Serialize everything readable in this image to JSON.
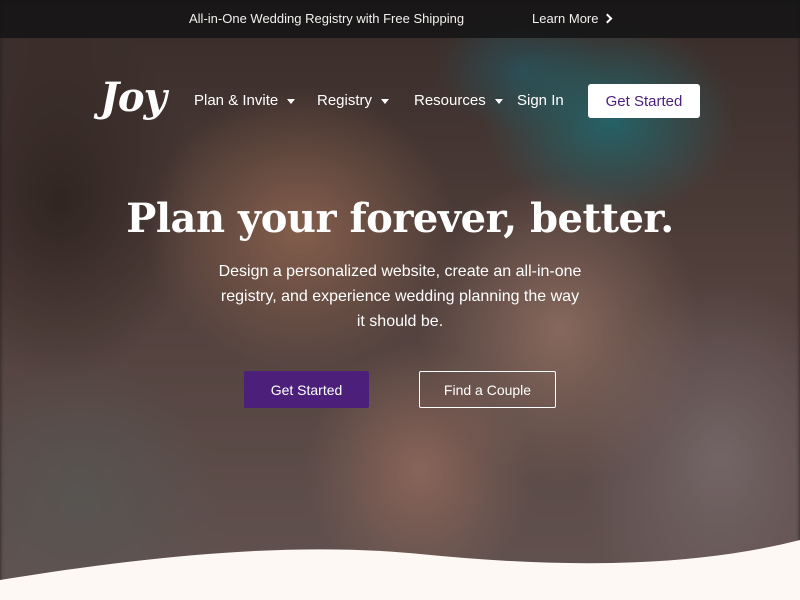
{
  "announcement": {
    "text": "All-in-One Wedding Registry with Free Shipping",
    "link_label": "Learn More"
  },
  "nav": {
    "logo": "Joy",
    "items": [
      {
        "label": "Plan & Invite",
        "has_dropdown": true
      },
      {
        "label": "Registry",
        "has_dropdown": true
      },
      {
        "label": "Resources",
        "has_dropdown": true
      },
      {
        "label": "Sign In",
        "has_dropdown": false
      }
    ],
    "cta_label": "Get Started"
  },
  "hero": {
    "headline": "Plan your forever, better.",
    "subhead": "Design a personalized website, create an all-in-one registry, and experience wedding planning the way it should be.",
    "primary_cta": "Get Started",
    "secondary_cta": "Find a Couple"
  },
  "colors": {
    "brand_purple": "#4b1f7a",
    "announcement_bg": "#141416",
    "page_bottom": "#fdf8f4"
  }
}
